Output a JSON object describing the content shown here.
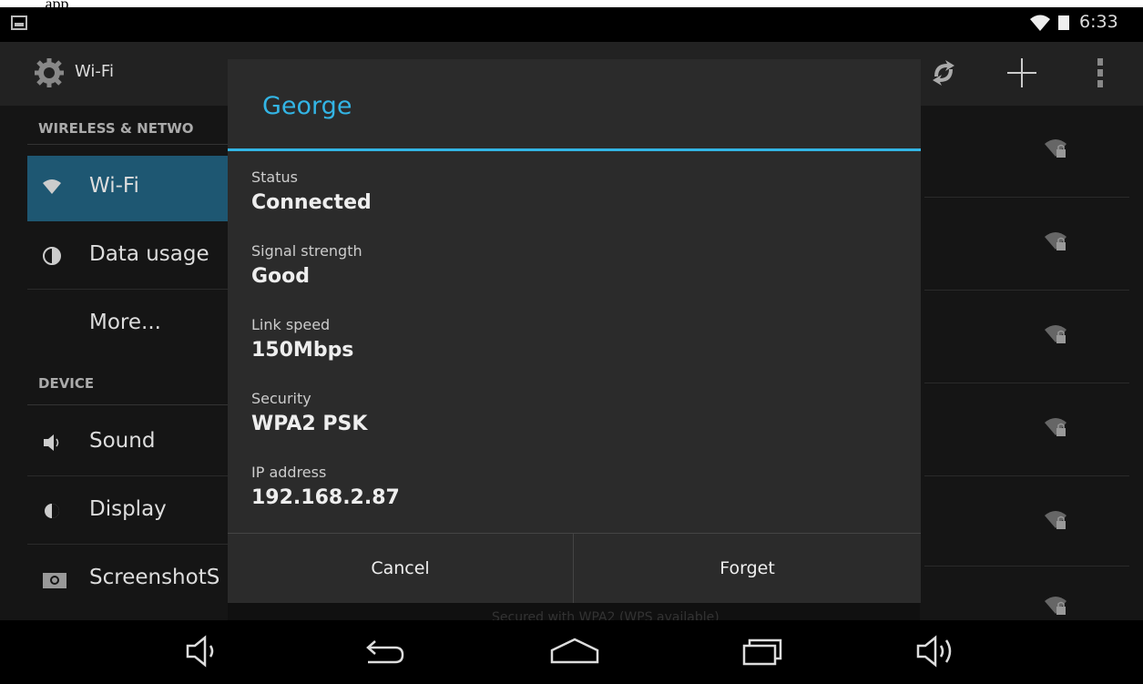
{
  "caption": "...app",
  "status_bar": {
    "time": "6:33",
    "icons": [
      "notification-icon",
      "wifi-icon",
      "battery-icon"
    ]
  },
  "action_bar": {
    "title": "Wi-Fi",
    "actions": [
      "wps-icon",
      "add-network-icon",
      "overflow-menu-icon"
    ]
  },
  "settings_list": {
    "section_wireless": "WIRELESS & NETWO",
    "wifi": "Wi-Fi",
    "data_usage": "Data usage",
    "more": "More...",
    "section_device": "DEVICE",
    "sound": "Sound",
    "display": "Display",
    "screenshot": "ScreenshotS"
  },
  "network_list_behind": {
    "partial_text": "Secured with WPA2 (WPS available)"
  },
  "dialog": {
    "title": "George",
    "fields": [
      {
        "label": "Status",
        "value": "Connected"
      },
      {
        "label": "Signal strength",
        "value": "Good"
      },
      {
        "label": "Link speed",
        "value": "150Mbps"
      },
      {
        "label": "Security",
        "value": "WPA2 PSK"
      },
      {
        "label": "IP address",
        "value": "192.168.2.87"
      }
    ],
    "cancel_label": "Cancel",
    "forget_label": "Forget"
  },
  "nav_bar": {
    "buttons": [
      "volume-down-icon",
      "back-icon",
      "home-icon",
      "recents-icon",
      "volume-up-icon"
    ]
  },
  "colors": {
    "accent": "#33b5e5",
    "selected_row": "#1e5772",
    "dialog_bg": "#2b2b2b"
  }
}
